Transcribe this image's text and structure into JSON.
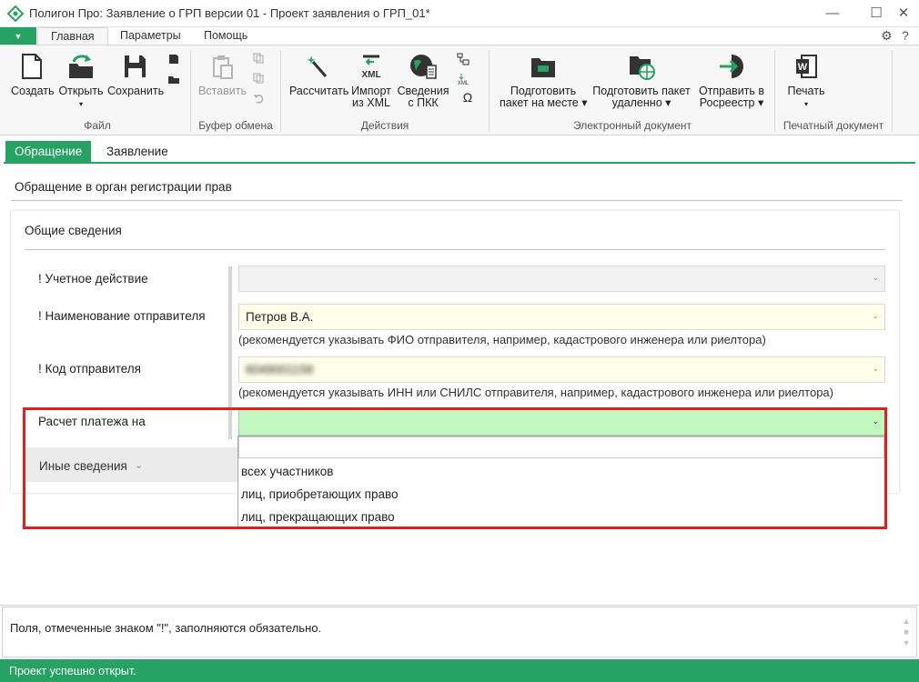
{
  "window": {
    "title": "Полигон Про: Заявление о ГРП версии 01 - Проект заявления о ГРП_01*",
    "minimize": "—",
    "maximize": "☐",
    "close": "✕"
  },
  "ribbon_tabs": [
    {
      "label": "Главная",
      "active": true
    },
    {
      "label": "Параметры",
      "active": false
    },
    {
      "label": "Помощь",
      "active": false
    }
  ],
  "app_menu_glyph": "▼",
  "top_icons": {
    "settings": "⚙",
    "help": "?"
  },
  "ribbon": {
    "file": {
      "group_label": "Файл",
      "create": "Создать",
      "open": "Открыть",
      "save": "Сохранить"
    },
    "clipboard": {
      "group_label": "Буфер обмена",
      "paste": "Вставить"
    },
    "actions": {
      "group_label": "Действия",
      "calc": "Рассчитать",
      "import_l1": "Импорт",
      "import_l2": "из XML",
      "pkk_l1": "Сведения",
      "pkk_l2": "с ПКК",
      "omega": "Ω"
    },
    "edoc": {
      "group_label": "Электронный документ",
      "prepare_local_l1": "Подготовить",
      "prepare_local_l2": "пакет на месте",
      "prepare_remote_l1": "Подготовить пакет",
      "prepare_remote_l2": "удаленно",
      "send_l1": "Отправить в",
      "send_l2": "Росреестр"
    },
    "print": {
      "group_label": "Печатный документ",
      "print": "Печать"
    },
    "dropdown_arrow": "▾"
  },
  "doc_tabs": [
    {
      "label": "Обращение",
      "active": true
    },
    {
      "label": "Заявление",
      "active": false
    }
  ],
  "section_title": "Обращение в орган регистрации прав",
  "card": {
    "title": "Общие сведения",
    "fields": {
      "action": {
        "label": "! Учетное действие",
        "value": ""
      },
      "sender_name": {
        "label": "! Наименование отправителя",
        "value": "Петров В.А.",
        "hint": "(рекомендуется указывать ФИО отправителя, например, кадастрового инженера или риелтора)"
      },
      "sender_code": {
        "label": "! Код отправителя",
        "value": "6049001158",
        "hint": "(рекомендуется указывать ИНН или СНИЛС отправителя, например, кадастрового инженера или риелтора)"
      },
      "payment": {
        "label": "Расчет платежа на",
        "value": ""
      }
    },
    "other": {
      "label": "Иные сведения"
    }
  },
  "dropdown": {
    "search_value": "",
    "options": [
      "всех участников",
      "лиц, приобретающих право",
      "лиц, прекращающих право"
    ]
  },
  "chevron": "⌄",
  "info_text": "Поля, отмеченные знаком \"!\", заполняются обязательно.",
  "status_text": "Проект успешно открыт.",
  "colors": {
    "accent": "#26a262",
    "required_field_bg": "#ffffea",
    "active_field_bg": "#c3f7c0",
    "highlight_border": "#e02020"
  }
}
